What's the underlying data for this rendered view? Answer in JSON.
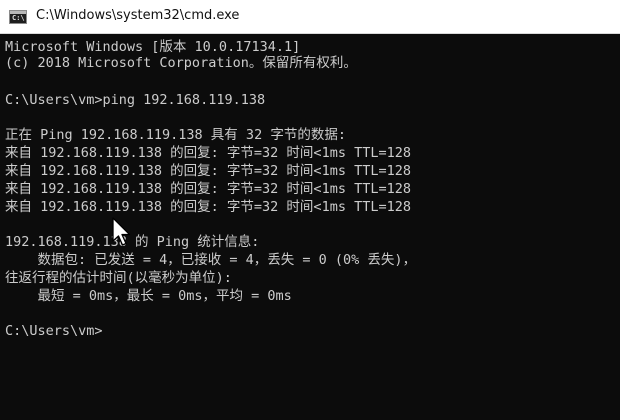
{
  "window": {
    "title": "C:\\Windows\\system32\\cmd.exe",
    "icon": "cmd-icon",
    "icon_glyph": "C:\\"
  },
  "console": {
    "lines": [
      "Microsoft Windows [版本 10.0.17134.1]",
      "(c) 2018 Microsoft Corporation。保留所有权利。",
      "",
      "C:\\Users\\vm>ping 192.168.119.138",
      "",
      "正在 Ping 192.168.119.138 具有 32 字节的数据:",
      "来自 192.168.119.138 的回复: 字节=32 时间<1ms TTL=128",
      "来自 192.168.119.138 的回复: 字节=32 时间<1ms TTL=128",
      "来自 192.168.119.138 的回复: 字节=32 时间<1ms TTL=128",
      "来自 192.168.119.138 的回复: 字节=32 时间<1ms TTL=128",
      "",
      "192.168.119.138 的 Ping 统计信息:",
      "    数据包: 已发送 = 4，已接收 = 4，丢失 = 0 (0% 丢失)，",
      "往返行程的估计时间(以毫秒为单位):",
      "    最短 = 0ms，最长 = 0ms，平均 = 0ms",
      "",
      "C:\\Users\\vm>"
    ],
    "text_color": "#cccccc",
    "background": "#0c0c0c"
  },
  "mouse_cursor": "arrow-cursor-icon"
}
